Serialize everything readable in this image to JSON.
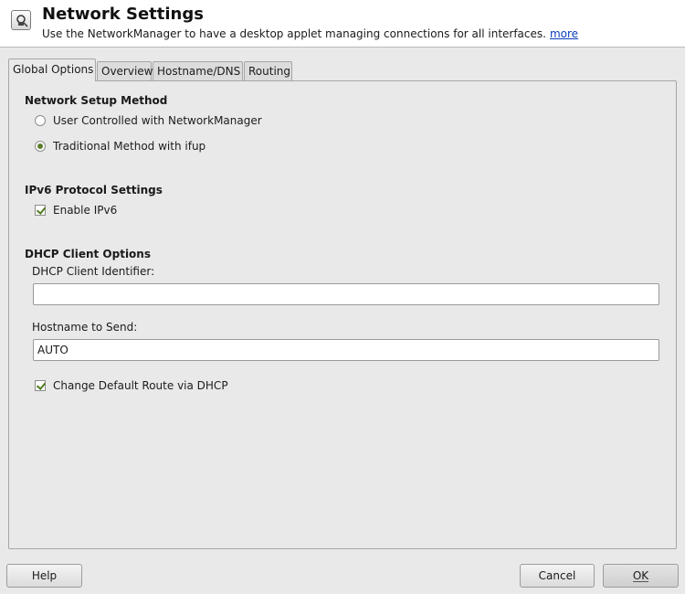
{
  "header": {
    "title": "Network Settings",
    "subtitle": "Use the NetworkManager to have a desktop applet managing connections for all interfaces.",
    "more_link": "more",
    "icon": "network-settings-icon"
  },
  "tabs": [
    {
      "label": "Global Options",
      "active": true
    },
    {
      "label": "Overview",
      "active": false
    },
    {
      "label": "Hostname/DNS",
      "active": false
    },
    {
      "label": "Routing",
      "active": false
    }
  ],
  "setup_method": {
    "title": "Network Setup Method",
    "options": [
      {
        "label": "User Controlled with NetworkManager",
        "selected": false
      },
      {
        "label": "Traditional Method with ifup",
        "selected": true
      }
    ]
  },
  "ipv6": {
    "title": "IPv6 Protocol Settings",
    "enable_label": "Enable IPv6",
    "enabled": true
  },
  "dhcp": {
    "title": "DHCP Client Options",
    "identifier_label": "DHCP Client Identifier:",
    "identifier_value": "",
    "hostname_label": "Hostname to Send:",
    "hostname_value": "AUTO",
    "default_route_label": "Change Default Route via DHCP",
    "default_route_checked": true
  },
  "buttons": {
    "help": "Help",
    "cancel": "Cancel",
    "ok": "OK"
  },
  "colors": {
    "accent_check": "#4f7a1d",
    "link": "#0b3dbd"
  }
}
